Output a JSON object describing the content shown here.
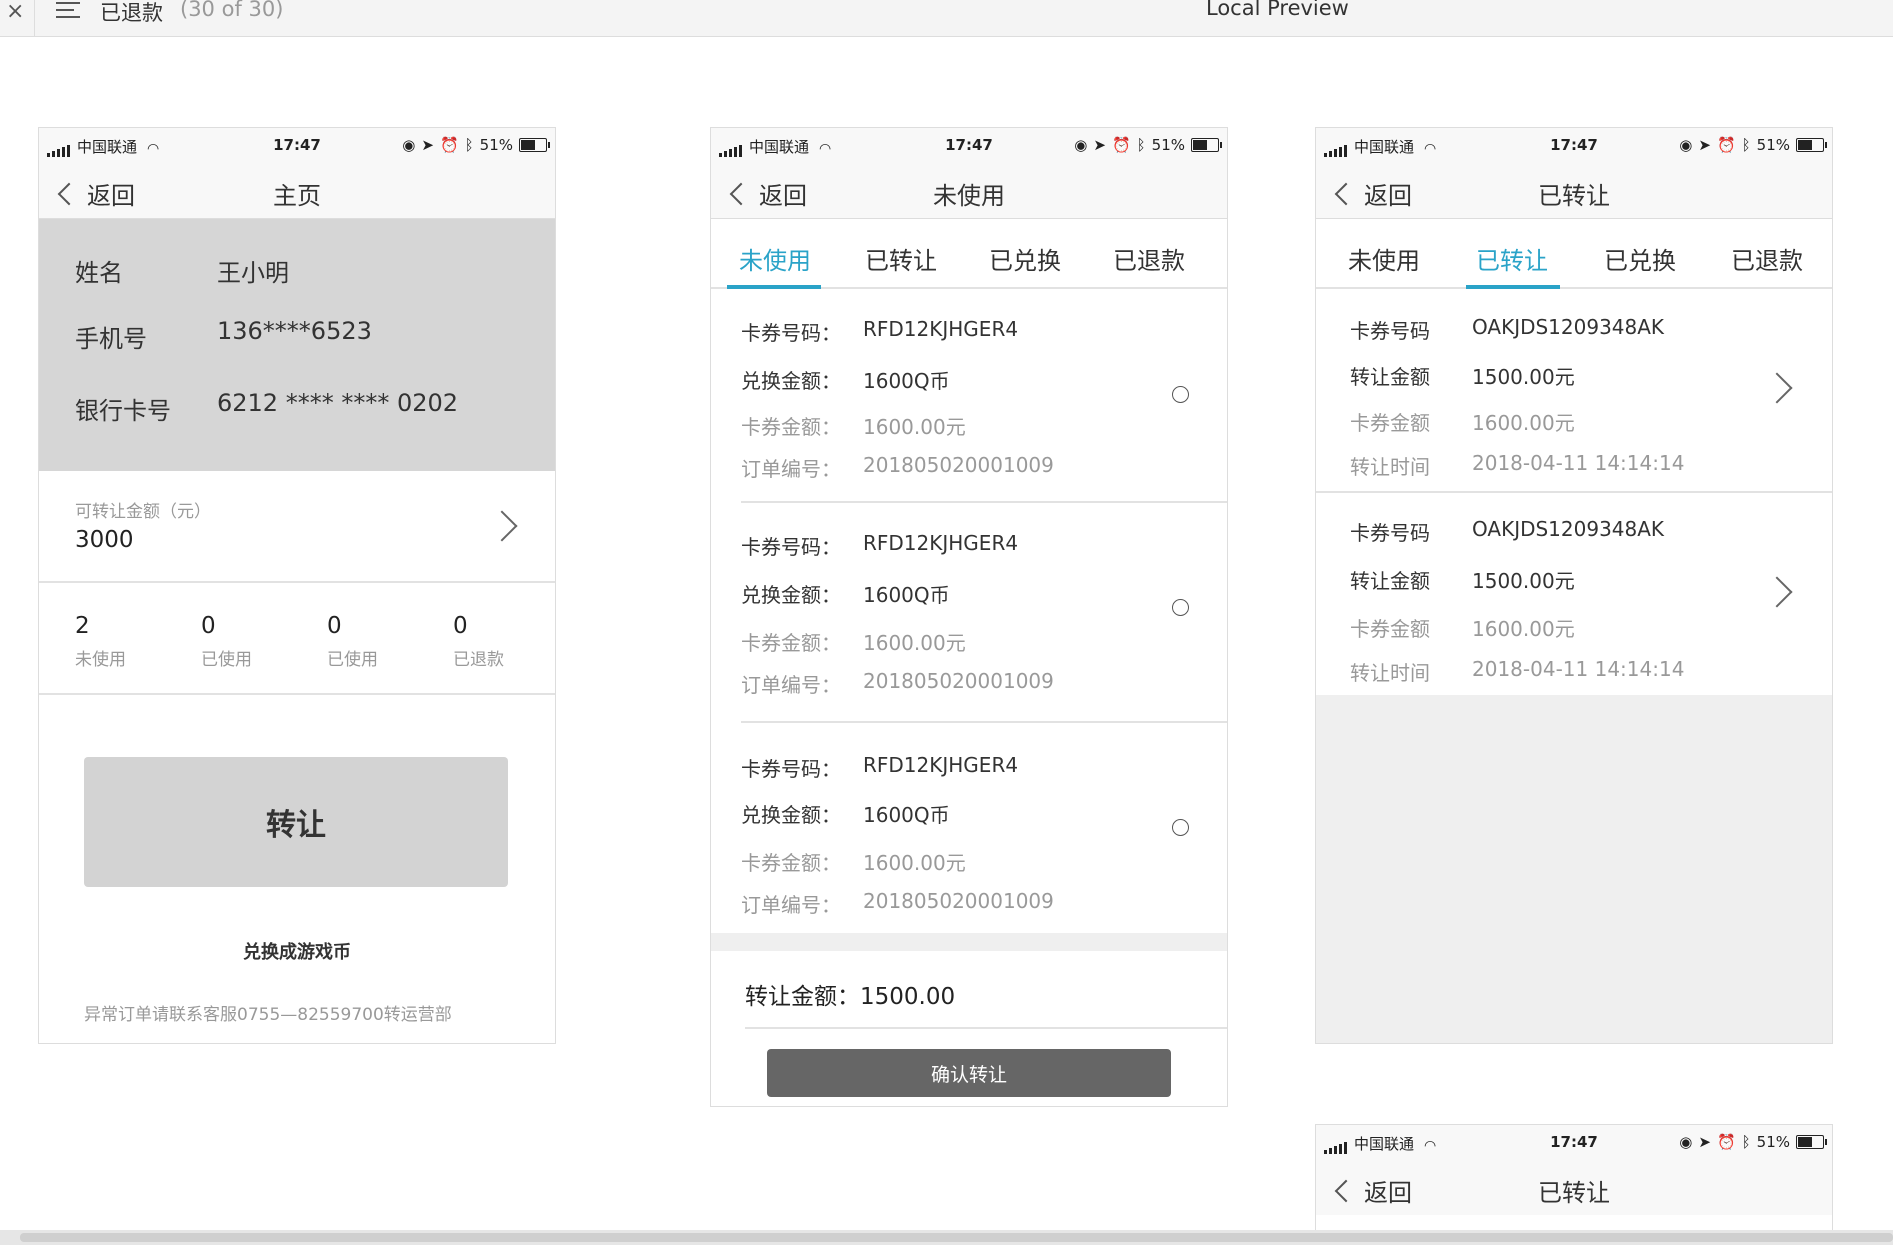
{
  "topbar": {
    "close": "×",
    "title": "已退款",
    "count": "(30 of 30)",
    "center_title": "Local Preview"
  },
  "status": {
    "carrier": "中国联通",
    "time": "17:47",
    "battery": "51%"
  },
  "nav": {
    "back": "返回"
  },
  "home": {
    "title": "主页",
    "name_label": "姓名",
    "name_value": "王小明",
    "phone_label": "手机号",
    "phone_value": "136****6523",
    "card_label": "银行卡号",
    "card_value": "6212 **** **** 0202",
    "available_label": "可转让金额（元）",
    "available_value": "3000",
    "stats": [
      {
        "n": "2",
        "l": "未使用"
      },
      {
        "n": "0",
        "l": "已使用"
      },
      {
        "n": "0",
        "l": "已使用"
      },
      {
        "n": "0",
        "l": "已退款"
      }
    ],
    "transfer_button": "转让",
    "exchange_text": "兑换成游戏币",
    "note": "异常订单请联系客服0755—82559700转运营部"
  },
  "tabs": [
    "未使用",
    "已转让",
    "已兑换",
    "已退款"
  ],
  "unused": {
    "title": "未使用",
    "labels": {
      "code": "卡券号码：",
      "exchange": "兑换金额：",
      "card": "卡券金额：",
      "order": "订单编号："
    },
    "items": [
      {
        "code": "RFD12KJHGER4",
        "exchange": "1600Q币",
        "card": "1600.00元",
        "order": "201805020001009"
      },
      {
        "code": "RFD12KJHGER4",
        "exchange": "1600Q币",
        "card": "1600.00元",
        "order": "201805020001009"
      },
      {
        "code": "RFD12KJHGER4",
        "exchange": "1600Q币",
        "card": "1600.00元",
        "order": "201805020001009"
      }
    ],
    "amount_label": "转让金额：",
    "amount_value": "1500.00",
    "confirm_button": "确认转让"
  },
  "transferred": {
    "title": "已转让",
    "labels": {
      "code": "卡券号码",
      "amount": "转让金额",
      "card": "卡券金额",
      "time": "转让时间"
    },
    "items": [
      {
        "code": "OAKJDS1209348AK",
        "amount": "1500.00元",
        "card": "1600.00元",
        "time": "2018-04-11 14:14:14"
      },
      {
        "code": "OAKJDS1209348AK",
        "amount": "1500.00元",
        "card": "1600.00元",
        "time": "2018-04-11 14:14:14"
      }
    ]
  },
  "fourth": {
    "title": "已转让"
  },
  "colors": {
    "accent": "#2aa3c8",
    "button_gray": "#666666",
    "info_bg": "#d6d6d6"
  }
}
